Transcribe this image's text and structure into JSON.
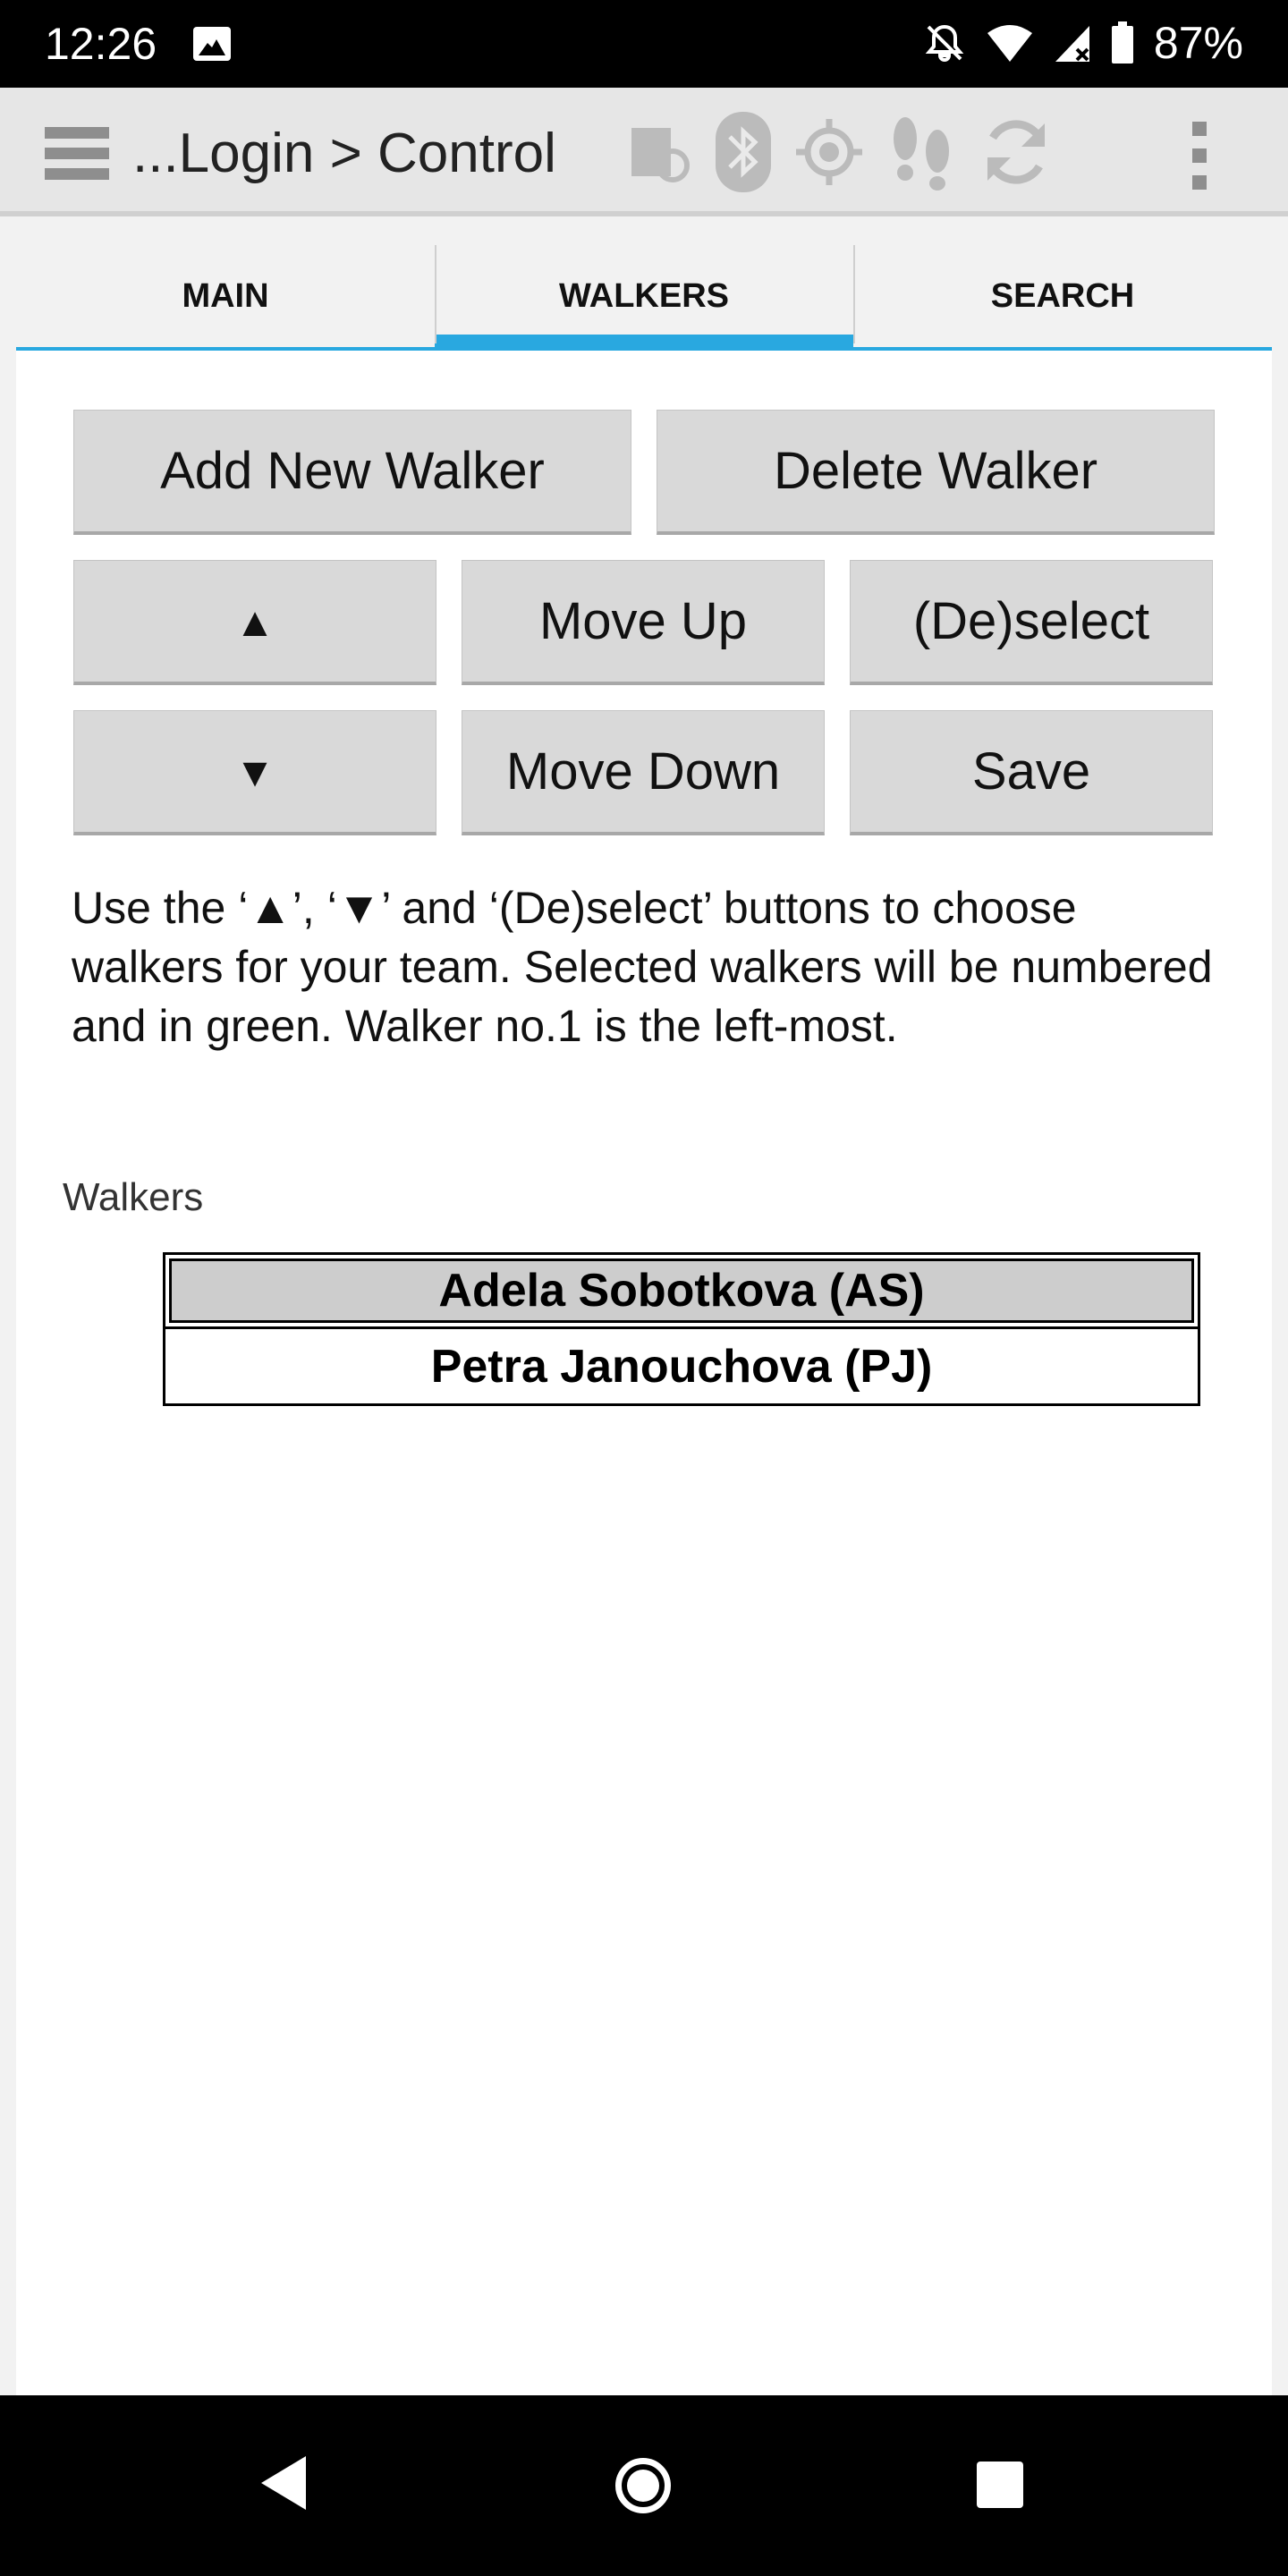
{
  "status_bar": {
    "time": "12:26",
    "battery": "87%",
    "icons": [
      "image-notification-icon",
      "mute-icon",
      "wifi-icon",
      "cell-signal-icon",
      "battery-icon"
    ]
  },
  "app_bar": {
    "title": "...Login > Control",
    "icons": [
      "menu-icon",
      "form-sync-icon",
      "bluetooth-icon",
      "gps-icon",
      "footsteps-icon",
      "sync-icon",
      "overflow-menu-icon"
    ]
  },
  "tabs": [
    {
      "label": "MAIN",
      "active": false
    },
    {
      "label": "WALKERS",
      "active": true
    },
    {
      "label": "SEARCH",
      "active": false
    }
  ],
  "buttons": {
    "add_new_walker": "Add New Walker",
    "delete_walker": "Delete Walker",
    "select_up": "▲",
    "move_up": "Move Up",
    "deselect": "(De)select",
    "select_down": "▼",
    "move_down": "Move Down",
    "save": "Save"
  },
  "instructions": "Use the ‘▲’, ‘▼’ and ‘(De)select’ buttons to choose walkers for your team. Selected walkers will be numbered and in green. Walker no.1 is the left-most.",
  "walkers": {
    "label": "Walkers",
    "items": [
      {
        "name": "Adela Sobotkova (AS)",
        "highlighted": true
      },
      {
        "name": "Petra Janouchova (PJ)",
        "highlighted": false
      }
    ]
  },
  "colors": {
    "tab_indicator": "#29a8e0",
    "button_bg": "#d9d9d9",
    "highlight_row": "#cdcdcd"
  }
}
